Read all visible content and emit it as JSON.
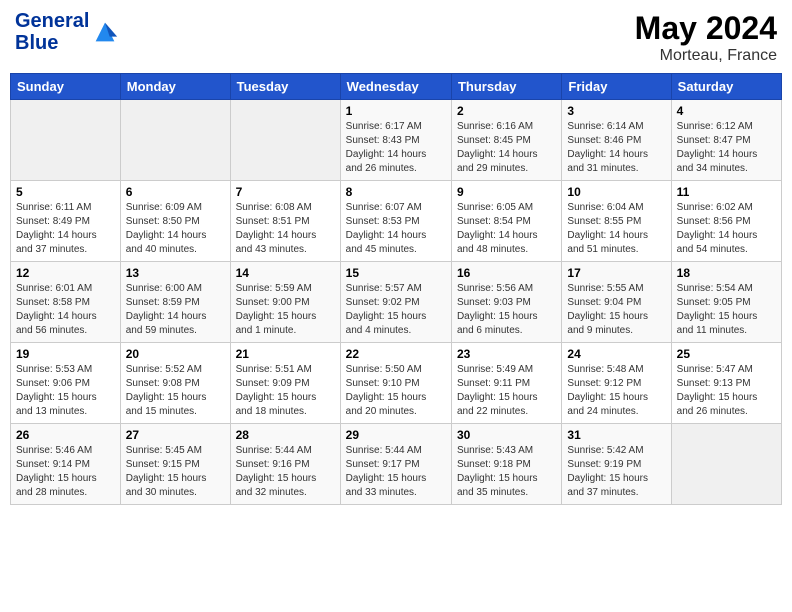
{
  "header": {
    "logo_line1": "General",
    "logo_line2": "Blue",
    "title": "May 2024",
    "subtitle": "Morteau, France"
  },
  "calendar": {
    "days_of_week": [
      "Sunday",
      "Monday",
      "Tuesday",
      "Wednesday",
      "Thursday",
      "Friday",
      "Saturday"
    ],
    "weeks": [
      [
        {
          "day": "",
          "info": ""
        },
        {
          "day": "",
          "info": ""
        },
        {
          "day": "",
          "info": ""
        },
        {
          "day": "1",
          "info": "Sunrise: 6:17 AM\nSunset: 8:43 PM\nDaylight: 14 hours\nand 26 minutes."
        },
        {
          "day": "2",
          "info": "Sunrise: 6:16 AM\nSunset: 8:45 PM\nDaylight: 14 hours\nand 29 minutes."
        },
        {
          "day": "3",
          "info": "Sunrise: 6:14 AM\nSunset: 8:46 PM\nDaylight: 14 hours\nand 31 minutes."
        },
        {
          "day": "4",
          "info": "Sunrise: 6:12 AM\nSunset: 8:47 PM\nDaylight: 14 hours\nand 34 minutes."
        }
      ],
      [
        {
          "day": "5",
          "info": "Sunrise: 6:11 AM\nSunset: 8:49 PM\nDaylight: 14 hours\nand 37 minutes."
        },
        {
          "day": "6",
          "info": "Sunrise: 6:09 AM\nSunset: 8:50 PM\nDaylight: 14 hours\nand 40 minutes."
        },
        {
          "day": "7",
          "info": "Sunrise: 6:08 AM\nSunset: 8:51 PM\nDaylight: 14 hours\nand 43 minutes."
        },
        {
          "day": "8",
          "info": "Sunrise: 6:07 AM\nSunset: 8:53 PM\nDaylight: 14 hours\nand 45 minutes."
        },
        {
          "day": "9",
          "info": "Sunrise: 6:05 AM\nSunset: 8:54 PM\nDaylight: 14 hours\nand 48 minutes."
        },
        {
          "day": "10",
          "info": "Sunrise: 6:04 AM\nSunset: 8:55 PM\nDaylight: 14 hours\nand 51 minutes."
        },
        {
          "day": "11",
          "info": "Sunrise: 6:02 AM\nSunset: 8:56 PM\nDaylight: 14 hours\nand 54 minutes."
        }
      ],
      [
        {
          "day": "12",
          "info": "Sunrise: 6:01 AM\nSunset: 8:58 PM\nDaylight: 14 hours\nand 56 minutes."
        },
        {
          "day": "13",
          "info": "Sunrise: 6:00 AM\nSunset: 8:59 PM\nDaylight: 14 hours\nand 59 minutes."
        },
        {
          "day": "14",
          "info": "Sunrise: 5:59 AM\nSunset: 9:00 PM\nDaylight: 15 hours\nand 1 minute."
        },
        {
          "day": "15",
          "info": "Sunrise: 5:57 AM\nSunset: 9:02 PM\nDaylight: 15 hours\nand 4 minutes."
        },
        {
          "day": "16",
          "info": "Sunrise: 5:56 AM\nSunset: 9:03 PM\nDaylight: 15 hours\nand 6 minutes."
        },
        {
          "day": "17",
          "info": "Sunrise: 5:55 AM\nSunset: 9:04 PM\nDaylight: 15 hours\nand 9 minutes."
        },
        {
          "day": "18",
          "info": "Sunrise: 5:54 AM\nSunset: 9:05 PM\nDaylight: 15 hours\nand 11 minutes."
        }
      ],
      [
        {
          "day": "19",
          "info": "Sunrise: 5:53 AM\nSunset: 9:06 PM\nDaylight: 15 hours\nand 13 minutes."
        },
        {
          "day": "20",
          "info": "Sunrise: 5:52 AM\nSunset: 9:08 PM\nDaylight: 15 hours\nand 15 minutes."
        },
        {
          "day": "21",
          "info": "Sunrise: 5:51 AM\nSunset: 9:09 PM\nDaylight: 15 hours\nand 18 minutes."
        },
        {
          "day": "22",
          "info": "Sunrise: 5:50 AM\nSunset: 9:10 PM\nDaylight: 15 hours\nand 20 minutes."
        },
        {
          "day": "23",
          "info": "Sunrise: 5:49 AM\nSunset: 9:11 PM\nDaylight: 15 hours\nand 22 minutes."
        },
        {
          "day": "24",
          "info": "Sunrise: 5:48 AM\nSunset: 9:12 PM\nDaylight: 15 hours\nand 24 minutes."
        },
        {
          "day": "25",
          "info": "Sunrise: 5:47 AM\nSunset: 9:13 PM\nDaylight: 15 hours\nand 26 minutes."
        }
      ],
      [
        {
          "day": "26",
          "info": "Sunrise: 5:46 AM\nSunset: 9:14 PM\nDaylight: 15 hours\nand 28 minutes."
        },
        {
          "day": "27",
          "info": "Sunrise: 5:45 AM\nSunset: 9:15 PM\nDaylight: 15 hours\nand 30 minutes."
        },
        {
          "day": "28",
          "info": "Sunrise: 5:44 AM\nSunset: 9:16 PM\nDaylight: 15 hours\nand 32 minutes."
        },
        {
          "day": "29",
          "info": "Sunrise: 5:44 AM\nSunset: 9:17 PM\nDaylight: 15 hours\nand 33 minutes."
        },
        {
          "day": "30",
          "info": "Sunrise: 5:43 AM\nSunset: 9:18 PM\nDaylight: 15 hours\nand 35 minutes."
        },
        {
          "day": "31",
          "info": "Sunrise: 5:42 AM\nSunset: 9:19 PM\nDaylight: 15 hours\nand 37 minutes."
        },
        {
          "day": "",
          "info": ""
        }
      ]
    ]
  }
}
